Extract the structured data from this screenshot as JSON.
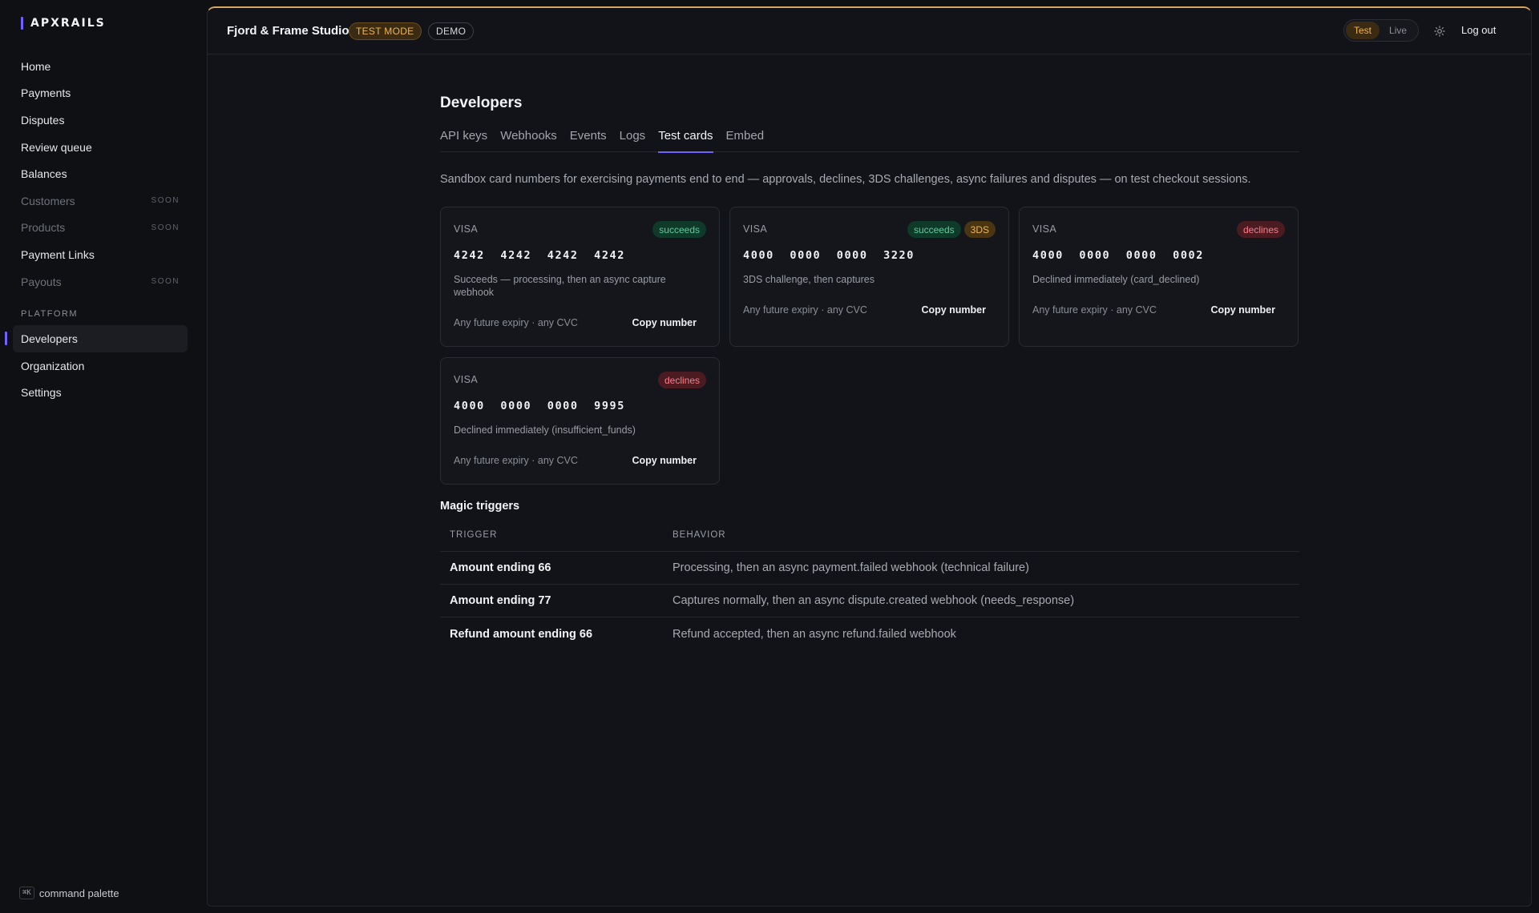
{
  "brand": {
    "name": "APXRAILS"
  },
  "sidebar": {
    "items": [
      {
        "label": "Home",
        "soon": ""
      },
      {
        "label": "Payments",
        "soon": ""
      },
      {
        "label": "Disputes",
        "soon": ""
      },
      {
        "label": "Review queue",
        "soon": ""
      },
      {
        "label": "Balances",
        "soon": ""
      },
      {
        "label": "Customers",
        "soon": "SOON"
      },
      {
        "label": "Products",
        "soon": "SOON"
      },
      {
        "label": "Payment Links",
        "soon": ""
      },
      {
        "label": "Payouts",
        "soon": "SOON"
      }
    ],
    "platform_section": "PLATFORM",
    "platform_items": [
      {
        "label": "Developers"
      },
      {
        "label": "Organization"
      },
      {
        "label": "Settings"
      }
    ],
    "command_palette": {
      "kbd": "⌘K",
      "label": "command palette"
    }
  },
  "header": {
    "org_name": "Fjord & Frame Studio",
    "test_mode_badge": "TEST MODE",
    "demo_badge": "DEMO",
    "mode_test": "Test",
    "mode_live": "Live",
    "selected_mode": "Test",
    "logout": "Log out"
  },
  "page": {
    "title": "Developers",
    "tabs": [
      "API keys",
      "Webhooks",
      "Events",
      "Logs",
      "Test cards",
      "Embed"
    ],
    "active_tab": "Test cards",
    "intro": "Sandbox card numbers for exercising payments end to end — approvals, declines, 3DS challenges, async failures and disputes — on test checkout sessions."
  },
  "cards": [
    {
      "brand": "VISA",
      "badges": [
        "succeeds"
      ],
      "number": "4242  4242  4242  4242",
      "description": "Succeeds — processing, then an async capture webhook",
      "expiry": "Any future expiry · any CVC",
      "copy": "Copy number"
    },
    {
      "brand": "VISA",
      "badges": [
        "succeeds",
        "3DS"
      ],
      "number": "4000  0000  0000  3220",
      "description": "3DS challenge, then captures",
      "expiry": "Any future expiry · any CVC",
      "copy": "Copy number"
    },
    {
      "brand": "VISA",
      "badges": [
        "declines"
      ],
      "number": "4000  0000  0000  0002",
      "description": "Declined immediately (card_declined)",
      "expiry": "Any future expiry · any CVC",
      "copy": "Copy number"
    },
    {
      "brand": "VISA",
      "badges": [
        "declines"
      ],
      "number": "4000  0000  0000  9995",
      "description": "Declined immediately (insufficient_funds)",
      "expiry": "Any future expiry · any CVC",
      "copy": "Copy number"
    }
  ],
  "magic_triggers": {
    "title": "Magic triggers",
    "headers": {
      "trigger": "TRIGGER",
      "behavior": "BEHAVIOR"
    },
    "rows": [
      {
        "trigger": "Amount ending 66",
        "behavior": "Processing, then an async payment.failed webhook (technical failure)"
      },
      {
        "trigger": "Amount ending 77",
        "behavior": "Captures normally, then an async dispute.created webhook (needs_response)"
      },
      {
        "trigger": "Refund amount ending 66",
        "behavior": "Refund accepted, then an async refund.failed webhook"
      }
    ]
  },
  "colors": {
    "accent": "#6f62ff",
    "test_mode": "#f0b451",
    "success": "#4ed39a",
    "decline": "#ff7b86"
  }
}
